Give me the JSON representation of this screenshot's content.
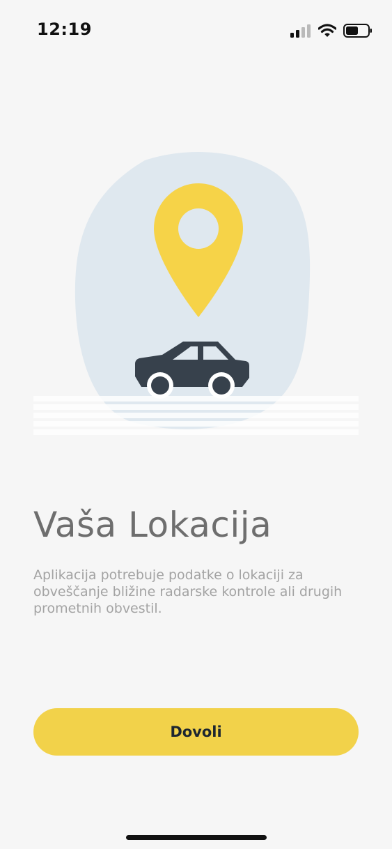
{
  "status_bar": {
    "time": "12:19",
    "icons": [
      "cellular-signal-icon",
      "wifi-icon",
      "battery-icon"
    ]
  },
  "illustration": {
    "icons": [
      "location-pin-icon",
      "car-icon"
    ]
  },
  "main": {
    "title": "Vaša Lokacija",
    "description": "Aplikacija potrebuje podatke o lokaciji za obveščanje bližine radarske kontrole ali drugih prometnih obvestil.",
    "allow_button_label": "Dovoli"
  },
  "colors": {
    "background": "#f6f6f6",
    "accent_yellow": "#f2d24a",
    "pin_yellow": "#f6d348",
    "car_dark": "#37414c",
    "blob_blue": "#dfe8ef",
    "title_gray": "#6e6e6e",
    "text_gray": "#a3a3a3"
  }
}
